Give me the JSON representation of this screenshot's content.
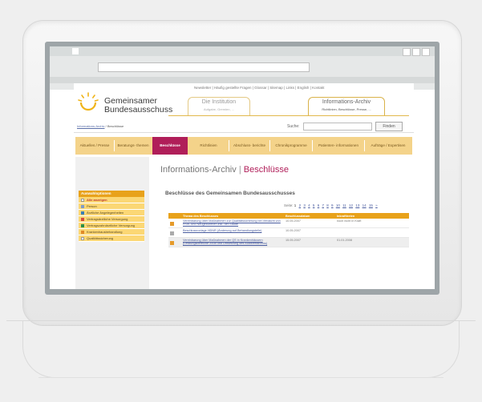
{
  "site": {
    "top_links": "Newsletter | Häufig gestellte Fragen | Glossar | Sitemap | Links | English | Kontakt",
    "logo_line1": "Gemeinsamer",
    "logo_line2": "Bundesausschuss",
    "tab_institution": {
      "title": "Die Institution",
      "sub": "Aufgabe, Gremien, ..."
    },
    "tab_archive": {
      "title": "Informations-Archiv",
      "sub": "Richtlinien, Beschlüsse, Presse, ..."
    }
  },
  "breadcrumb": {
    "link": "Informations-Archiv",
    "current": "Beschlüsse"
  },
  "search": {
    "label": "Suche:",
    "button": "Finden"
  },
  "mainnav": [
    {
      "label": "Aktuelles / Presse"
    },
    {
      "label": "Beratungs- themen"
    },
    {
      "label": "Beschlüsse"
    },
    {
      "label": "Richtlinien"
    },
    {
      "label": "Abschluss- berichte"
    },
    {
      "label": "Chronikprogramme"
    },
    {
      "label": "Patienten- informationen"
    },
    {
      "label": "Aufträge / Expertisen"
    }
  ],
  "sidebar": {
    "title": "Auswahloptionen",
    "items": [
      {
        "label": "Alle anzeigen",
        "color": "#ffffff"
      },
      {
        "label": "Person",
        "color": "#7f9cc8"
      },
      {
        "label": "Ärztliche Angelegenheiten",
        "color": "#3a7fb5"
      },
      {
        "label": "Vertragsärztliche Versorgung",
        "color": "#d64a3c"
      },
      {
        "label": "Vertragszahnärztliche Versorgung",
        "color": "#2a8f4a"
      },
      {
        "label": "Krankenhausbehandlung",
        "color": "#e08a2a"
      },
      {
        "label": "Qualitätssicherung",
        "color": "#ffffff"
      }
    ]
  },
  "content": {
    "title_a": "Informations-Archiv",
    "title_sep": "|",
    "title_b": "Beschlüsse",
    "list_heading": "Beschlüsse des Gemeinsamen Bundesausschusses",
    "pager_label": "Seite:",
    "pages": [
      "1",
      "2",
      "3",
      "4",
      "5",
      "6",
      "7",
      "8",
      "9",
      "10",
      "11",
      "12",
      "13",
      "14",
      "15",
      "»"
    ],
    "table": {
      "headers": [
        "Thema des Beschlusses",
        "Beschlussdatum",
        "Inkrafttreten"
      ],
      "rows": [
        {
          "title": "Vereinbarung über Maßnahmen zur Qualitätssicherung bei Verdacht von Früh- und Neugeborenen inkl. der Städte",
          "date": "10.05.2007",
          "effective": "noch nicht in Kraft"
        },
        {
          "title": "Beschlussvorlage HDNR (Änderung auf Behandlungstelle)",
          "date": "10.05.2007",
          "effective": ""
        },
        {
          "title": "Vereinbarung über Maßnahmen der QS in Krankenhäusern (Leistungsbereiche 2008 und Umsetzung des Auditverfahrens)",
          "date": "15.05.2007",
          "effective": "01.01.2008"
        }
      ]
    }
  },
  "colors": {
    "accent": "#b01e59",
    "nav_bg": "#f4d38a",
    "orange": "#e8a21b"
  }
}
